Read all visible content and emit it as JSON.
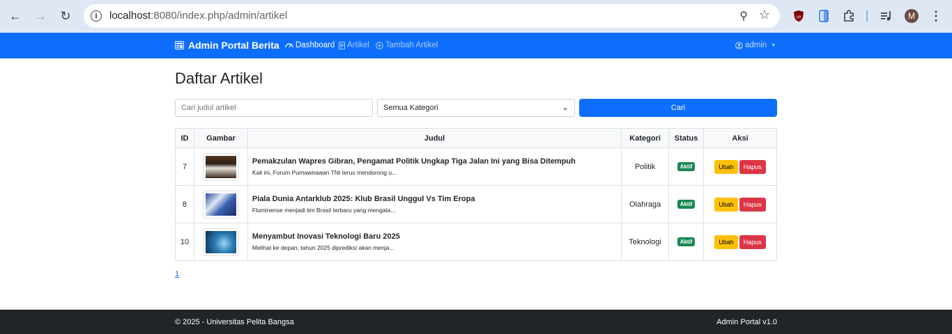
{
  "browser": {
    "url_host": "localhost",
    "url_path": ":8080/index.php/admin/artikel",
    "profile_initial": "M"
  },
  "navbar": {
    "brand": "Admin Portal Berita",
    "links": [
      {
        "label": "Dashboard"
      },
      {
        "label": "Artikel"
      },
      {
        "label": "Tambah Artikel"
      }
    ],
    "user": "admin"
  },
  "page": {
    "title": "Daftar Artikel",
    "search_placeholder": "Cari judul artikel",
    "category_select": "Semua Kategori",
    "search_button": "Cari"
  },
  "table": {
    "headers": [
      "ID",
      "Gambar",
      "Judul",
      "Kategori",
      "Status",
      "Aksi"
    ],
    "rows": [
      {
        "id": "7",
        "title": "Pemakzulan Wapres Gibran, Pengamat Politik Ungkap Tiga Jalan Ini yang Bisa Ditempuh",
        "snippet": "Kali ini, Forum Purnawirawan TNI terus mendorong u...",
        "category": "Politik",
        "status": "Aktif",
        "edit": "Ubah",
        "delete": "Hapus"
      },
      {
        "id": "8",
        "title": "Piala Dunia Antarklub 2025: Klub Brasil Unggul Vs Tim Eropa",
        "snippet": "Fluminense menjadi tim Brasil terbaru yang mengala...",
        "category": "Olahraga",
        "status": "Aktif",
        "edit": "Ubah",
        "delete": "Hapus"
      },
      {
        "id": "10",
        "title": "Menyambut Inovasi Teknologi Baru 2025",
        "snippet": "Melihat ke depan, tahun 2025 diprediksi akan menja...",
        "category": "Teknologi",
        "status": "Aktif",
        "edit": "Ubah",
        "delete": "Hapus"
      }
    ]
  },
  "pagination": {
    "current": "1"
  },
  "footer": {
    "copyright": "© 2025 - Universitas Pelita Bangsa",
    "version": "Admin Portal v1.0"
  },
  "colors": {
    "primary": "#0d6efd",
    "success": "#198754",
    "warning": "#ffc107",
    "danger": "#dc3545",
    "footer": "#212529"
  }
}
